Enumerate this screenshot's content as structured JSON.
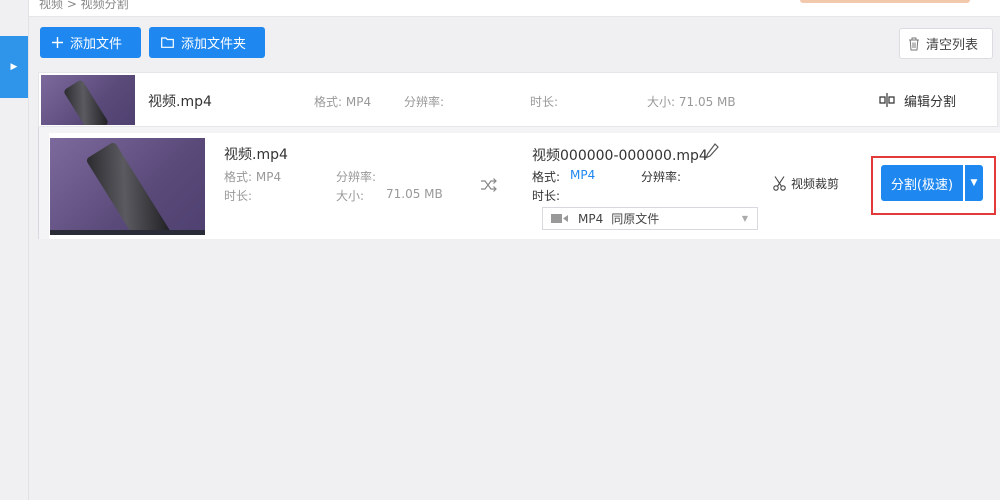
{
  "breadcrumb": {
    "text": "视频 > 视频分割"
  },
  "toolbar": {
    "add_file_label": "添加文件",
    "add_folder_label": "添加文件夹",
    "clear_list_label": "清空列表"
  },
  "file_row": {
    "name": "视频.mp4",
    "format_label": "格式: MP4",
    "resolution_label": "分辨率:",
    "duration_label": "时长:",
    "size_label": "大小: 71.05 MB",
    "edit_split_label": "编辑分割"
  },
  "task_row": {
    "source": {
      "name": "视频.mp4",
      "format_label": "格式: MP4",
      "resolution_label": "分辨率:",
      "duration_label": "时长:",
      "size_label": "大小:",
      "size_value": "71.05 MB"
    },
    "output": {
      "name": "视频000000-000000.mp4",
      "format_key": "格式:",
      "format_value": "MP4",
      "resolution_label": "分辨率:",
      "duration_label": "时长:",
      "preset_format": "MP4",
      "preset_option": "同原文件"
    },
    "trim_label": "视频裁剪",
    "split_button_label": "分割(极速)"
  },
  "colors": {
    "primary": "#1e88f0",
    "highlight_border": "#e23a3a",
    "background": "#f0eff2"
  },
  "icons": [
    "sidebar-expand-icon",
    "plus-icon",
    "folder-icon",
    "trash-icon",
    "split-icon",
    "shuffle-icon",
    "scissors-icon",
    "pencil-icon",
    "video-icon",
    "chevron-down-icon"
  ]
}
